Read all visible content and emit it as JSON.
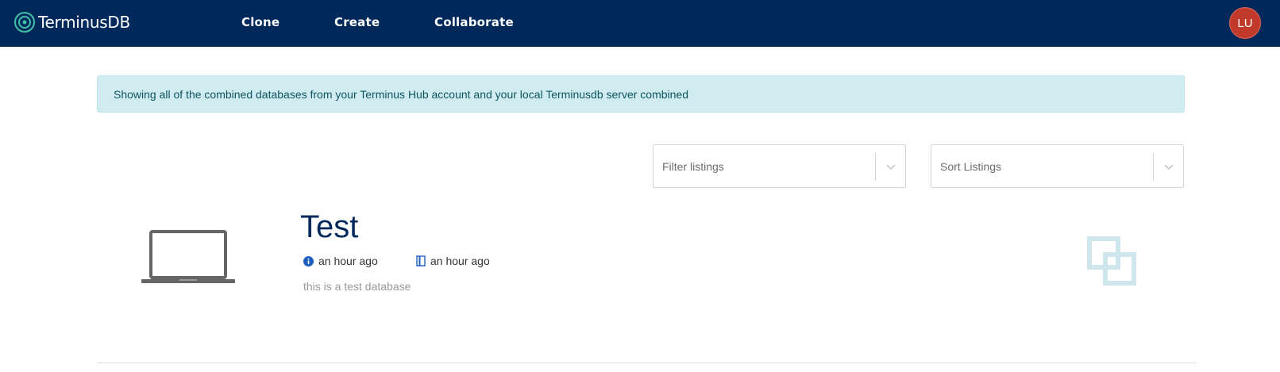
{
  "header": {
    "brand": "TerminusDB",
    "nav": {
      "clone": "Clone",
      "create": "Create",
      "collaborate": "Collaborate"
    },
    "avatar_initials": "LU"
  },
  "alert": {
    "message": "Showing all of the combined databases from your Terminus Hub account and your local Terminusdb server combined"
  },
  "filters": {
    "filter_placeholder": "Filter listings",
    "sort_placeholder": "Sort Listings"
  },
  "databases": [
    {
      "title": "Test",
      "created": "an hour ago",
      "updated": "an hour ago",
      "description": "this is a test database",
      "location_icon": "laptop-icon",
      "action_icon": "clone-icon"
    }
  ],
  "colors": {
    "navbar": "#00295b",
    "alert_bg": "#d1ecf1",
    "alert_text": "#0c5460",
    "title": "#00295b",
    "avatar": "#c0392b",
    "info_icon": "#1f5fbf",
    "clone_icon": "#cfe7ec"
  }
}
